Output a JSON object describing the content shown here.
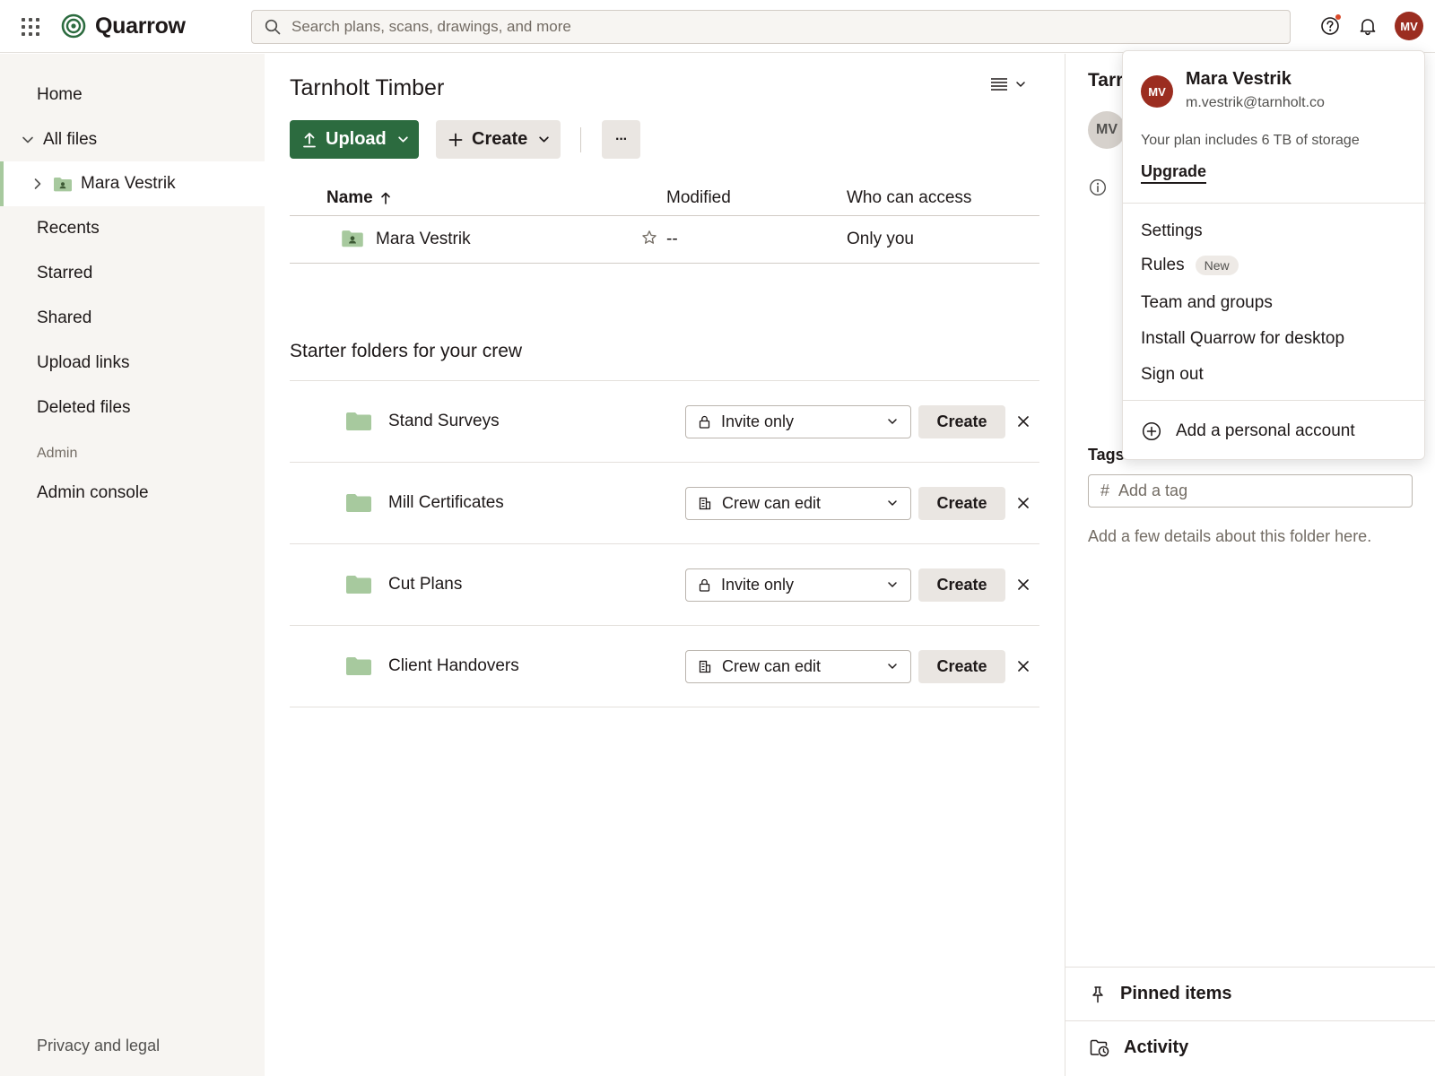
{
  "app": {
    "name": "Quarrow"
  },
  "search": {
    "placeholder": "Search plans, scans, drawings, and more"
  },
  "topbar": {
    "avatar_initials": "MV"
  },
  "sidebar": {
    "home": "Home",
    "all_files": "All files",
    "folder_child": "Mara Vestrik",
    "recents": "Recents",
    "starred": "Starred",
    "shared": "Shared",
    "upload_links": "Upload links",
    "deleted_files": "Deleted files",
    "admin_label": "Admin",
    "admin_console": "Admin console",
    "privacy": "Privacy and legal"
  },
  "main": {
    "title": "Tarnholt Timber",
    "upload_label": "Upload",
    "create_label": "Create",
    "more_label": "···",
    "columns": {
      "name": "Name",
      "modified": "Modified",
      "access": "Who can access"
    },
    "rows": [
      {
        "name": "Mara Vestrik",
        "modified": "--",
        "access": "Only you"
      }
    ],
    "starter_title": "Starter folders for your crew",
    "starter_create_label": "Create",
    "starter_folders": [
      {
        "name": "Stand Surveys",
        "access": "Invite only",
        "access_icon": "lock-icon"
      },
      {
        "name": "Mill Certificates",
        "access": "Crew can edit",
        "access_icon": "building-icon"
      },
      {
        "name": "Cut Plans",
        "access": "Invite only",
        "access_icon": "lock-icon"
      },
      {
        "name": "Client Handovers",
        "access": "Crew can edit",
        "access_icon": "building-icon"
      }
    ]
  },
  "right_panel": {
    "title": "Tarr",
    "avatar_initials": "MV",
    "tags_label": "Tags",
    "tag_placeholder": "Add a tag",
    "description": "Add a few details about this folder here.",
    "pinned": "Pinned items",
    "activity": "Activity"
  },
  "account_menu": {
    "avatar_initials": "MV",
    "name": "Mara Vestrik",
    "email": "m.vestrik@tarnholt.co",
    "plan": "Your plan includes 6 TB of storage",
    "upgrade": "Upgrade",
    "items": {
      "settings": "Settings",
      "rules": "Rules",
      "rules_badge": "New",
      "team": "Team and groups",
      "install": "Install Quarrow for desktop",
      "sign_out": "Sign out"
    },
    "add_account": "Add a personal account"
  },
  "colors": {
    "brand_green": "#2c6b3f",
    "folder_green": "#a7c99e",
    "avatar_red": "#9b2d20",
    "notification_dot": "#d94a2a"
  }
}
